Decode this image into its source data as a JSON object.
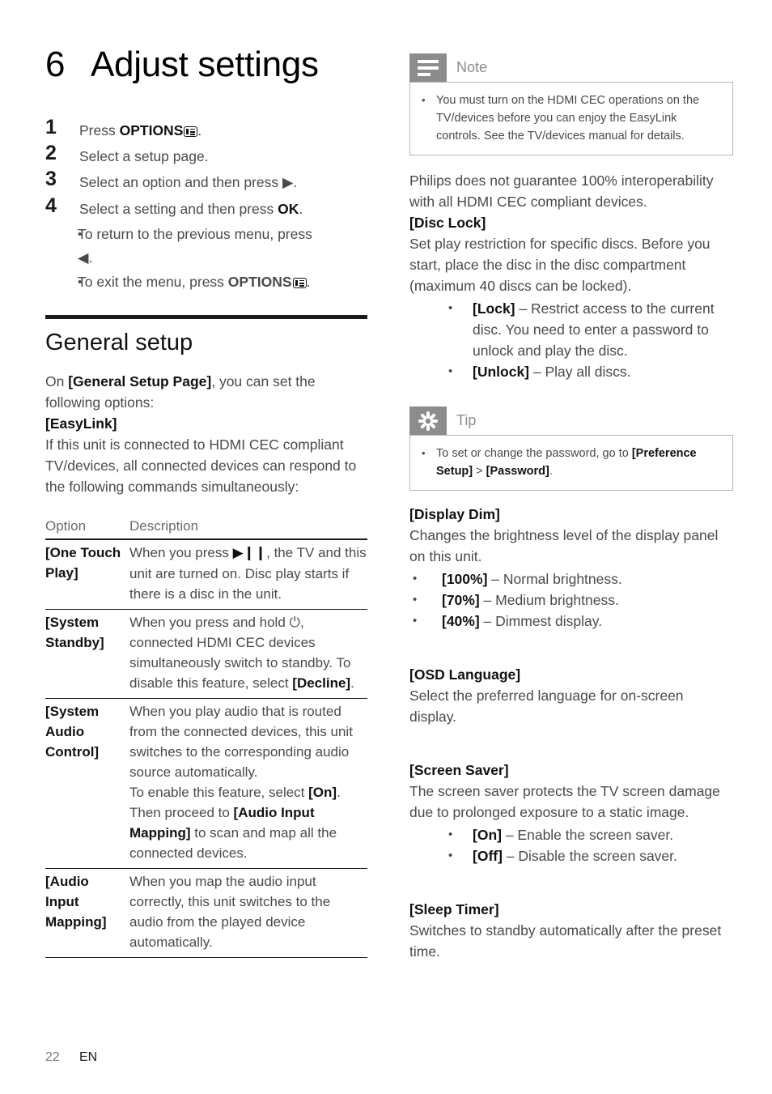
{
  "chapter": {
    "number": "6",
    "title": "Adjust settings"
  },
  "steps": [
    {
      "num": "1",
      "pre": "Press ",
      "bold": "OPTIONS",
      "icon": "options-icon",
      "post": "."
    },
    {
      "num": "2",
      "pre": "Select a setup page.",
      "bold": "",
      "post": ""
    },
    {
      "num": "3",
      "pre": "Select an option and then press ",
      "glyph": "▶",
      "post": "."
    },
    {
      "num": "4",
      "pre": "Select a setting and then press ",
      "bold": "OK",
      "post": "."
    }
  ],
  "sub_bullets": [
    {
      "bullet": "•",
      "text": "To return to the previous menu, press",
      "glyph": "◀",
      "post": "."
    },
    {
      "bullet": "•",
      "pre": "To exit the menu, press ",
      "bold": "OPTIONS",
      "icon": "options-icon",
      "post": "."
    }
  ],
  "section": {
    "title": "General setup",
    "intro_pre": "On ",
    "intro_bold": "[General Setup Page]",
    "intro_post": ", you can set the following options:",
    "easylink_term": "[EasyLink]",
    "easylink_body": "If this unit is connected to HDMI CEC compliant TV/devices, all connected devices can respond to the following commands simultaneously:"
  },
  "table": {
    "headers": [
      "Option",
      "Description"
    ],
    "rows": [
      {
        "option": "[One Touch Play]",
        "desc_parts": [
          {
            "t": "When you press "
          },
          {
            "t": "▶❙❙",
            "bold": true
          },
          {
            "t": ", the TV and this unit are turned on. Disc play starts if there is a disc in the unit."
          }
        ]
      },
      {
        "option": "[System Standby]",
        "desc_parts": [
          {
            "t": "When you press and hold ⏻"
          },
          {
            "t": ", connected HDMI CEC devices simultaneously switch to standby. To disable this feature, select "
          },
          {
            "t": "[Decline]",
            "bold": true
          },
          {
            "t": "."
          }
        ]
      },
      {
        "option": "[System Audio Control]",
        "desc_parts": [
          {
            "t": "When you play audio that is routed from the connected devices, this unit switches to the corresponding audio source automatically."
          },
          {
            "t": "\nTo enable this feature, select "
          },
          {
            "t": "[On]",
            "bold": true
          },
          {
            "t": ". Then proceed to "
          },
          {
            "t": "[Audio Input Mapping]",
            "bold": true
          },
          {
            "t": " to scan and map all the connected devices."
          }
        ]
      },
      {
        "option": "[Audio Input Mapping]",
        "desc_parts": [
          {
            "t": "When you map the audio input correctly, this unit switches to the audio from the played device automatically."
          }
        ]
      }
    ]
  },
  "note_box": {
    "label": "Note",
    "icon": "note-lines-icon",
    "bullet": "•",
    "text": "You must turn on the HDMI CEC operations on the TV/devices before you can enjoy the EasyLink controls. See the TV/devices manual for details."
  },
  "tip_box": {
    "label": "Tip",
    "icon": "starburst-icon",
    "bullet": "•",
    "pre": "To set or change the password, go to ",
    "bold1": "[Preference Setup]",
    "mid": " > ",
    "bold2": "[Password]",
    "post": "."
  },
  "right": {
    "philips_para": "Philips does not guarantee 100% interoperability with all HDMI CEC compliant devices.",
    "disc_lock_term": "[Disc Lock]",
    "disc_lock_body": "Set play restriction for specific discs. Before you start, place the disc in the disc compartment (maximum 40 discs can be locked).",
    "disc_lock_items": [
      {
        "bullet": "•",
        "bold": "[Lock]",
        "text": " – Restrict access to the current disc. You need to enter a password to unlock and play the disc."
      },
      {
        "bullet": "•",
        "bold": "[Unlock]",
        "text": " – Play all discs."
      }
    ],
    "display_dim_term": "[Display Dim]",
    "display_dim_body": "Changes the brightness level of the display panel on this unit.",
    "display_dim_items": [
      {
        "bullet": "•",
        "bold": "[100%]",
        "text": " – Normal brightness."
      },
      {
        "bullet": "•",
        "bold": "[70%]",
        "text": " – Medium brightness."
      },
      {
        "bullet": "•",
        "bold": "[40%]",
        "text": " – Dimmest display."
      }
    ],
    "osd_term": "[OSD Language]",
    "osd_body": "Select the preferred language for on-screen display.",
    "screen_saver_term": "[Screen Saver]",
    "screen_saver_body": "The screen saver protects the TV screen damage due to prolonged exposure to a static image.",
    "screen_saver_items": [
      {
        "bullet": "•",
        "bold": "[On]",
        "text": " – Enable the screen saver."
      },
      {
        "bullet": "•",
        "bold": "[Off]",
        "text": " – Disable the screen saver."
      }
    ],
    "sleep_timer_term": "[Sleep Timer]",
    "sleep_timer_body": "Switches to standby automatically after the preset time."
  },
  "footer": {
    "page_number": "22",
    "language": "EN"
  },
  "colors": {
    "text": "#4a4a4a",
    "bold_text": "#111111",
    "rule": "#1a1a1a",
    "callout_gray": "#8c8c8c",
    "callout_border": "#b5b5b5"
  }
}
